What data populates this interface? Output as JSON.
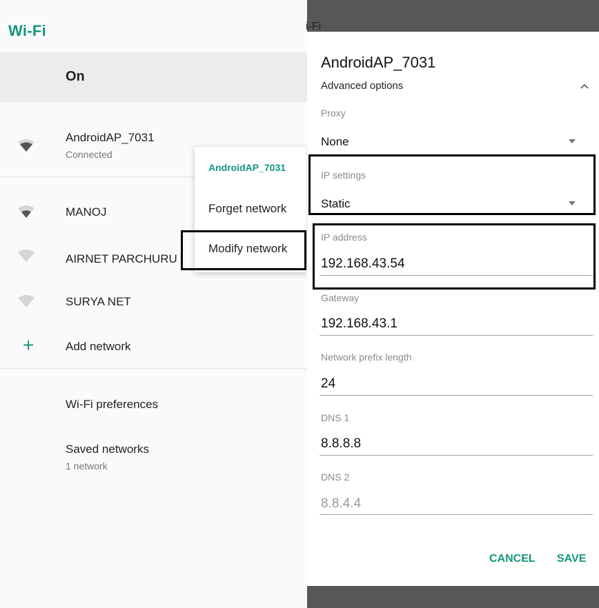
{
  "left": {
    "title": "Wi-Fi",
    "toggle_label": "On",
    "networks": [
      {
        "name": "AndroidAP_7031",
        "status": "Connected"
      },
      {
        "name": "MANOJ"
      },
      {
        "name": "AIRNET PARCHURU"
      },
      {
        "name": "SURYA NET"
      }
    ],
    "add_network": "Add network",
    "preferences": "Wi-Fi preferences",
    "saved_networks": {
      "label": "Saved networks",
      "count": "1 network"
    },
    "context_menu": {
      "title": "AndroidAP_7031",
      "items": [
        "Forget network",
        "Modify network"
      ]
    },
    "accent_color": "#14967c"
  },
  "dialog": {
    "peek_title": "i-Fi",
    "title": "AndroidAP_7031",
    "advanced_options": "Advanced options",
    "proxy": {
      "label": "Proxy",
      "value": "None"
    },
    "ip_settings": {
      "label": "IP settings",
      "value": "Static"
    },
    "ip_address": {
      "label": "IP address",
      "value": "192.168.43.54"
    },
    "gateway": {
      "label": "Gateway",
      "value": "192.168.43.1"
    },
    "prefix_length": {
      "label": "Network prefix length",
      "value": "24"
    },
    "dns1": {
      "label": "DNS 1",
      "value": "8.8.8.8"
    },
    "dns2": {
      "label": "DNS 2",
      "placeholder": "8.8.4.4"
    },
    "cancel_label": "CANCEL",
    "save_label": "SAVE"
  },
  "icons": {
    "wifi_signal": "wifi-signal-icon",
    "add": "plus-icon",
    "chevron_up": "chevron-up-icon",
    "dropdown": "dropdown-caret-icon"
  }
}
